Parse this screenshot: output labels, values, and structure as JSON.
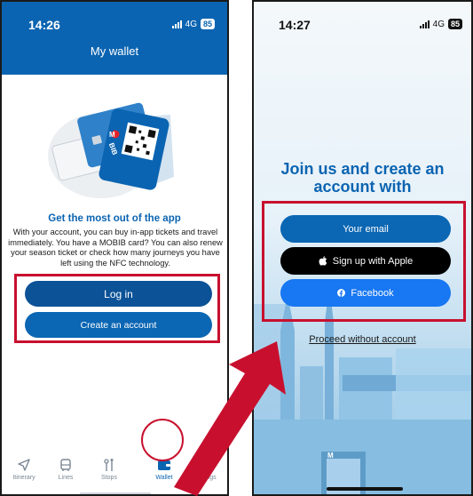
{
  "left_screen": {
    "status": {
      "time": "14:26",
      "network": "4G",
      "battery": "85"
    },
    "header_title": "My wallet",
    "card_label": "BIB",
    "card_letter": "M",
    "headline": "Get the most out of the app",
    "body": "With your account, you can buy in-app tickets and travel immediately. You have a MOBIB card? You can also renew your season ticket or check how many journeys you have left using the NFC technology.",
    "login_label": "Log in",
    "create_account_label": "Create an account",
    "nav": [
      {
        "label": "Itinerary",
        "icon": "navigation-arrow-icon"
      },
      {
        "label": "Lines",
        "icon": "bus-icon"
      },
      {
        "label": "Stops",
        "icon": "stops-icon"
      },
      {
        "label": "Wallet",
        "icon": "wallet-icon",
        "active": true
      },
      {
        "label": "Settings",
        "icon": "gear-icon"
      }
    ]
  },
  "right_screen": {
    "status": {
      "time": "14:27",
      "network": "4G",
      "battery": "85"
    },
    "title": "Join us and create an account with",
    "email_label": "Your email",
    "apple_label": "Sign up with Apple",
    "facebook_label": "Facebook",
    "proceed_label": "Proceed without account",
    "building_sign": "M"
  },
  "colors": {
    "brand_blue": "#0b64b1",
    "dark_blue": "#0b5297",
    "facebook_blue": "#1877f2",
    "highlight_red": "#c8102e"
  }
}
